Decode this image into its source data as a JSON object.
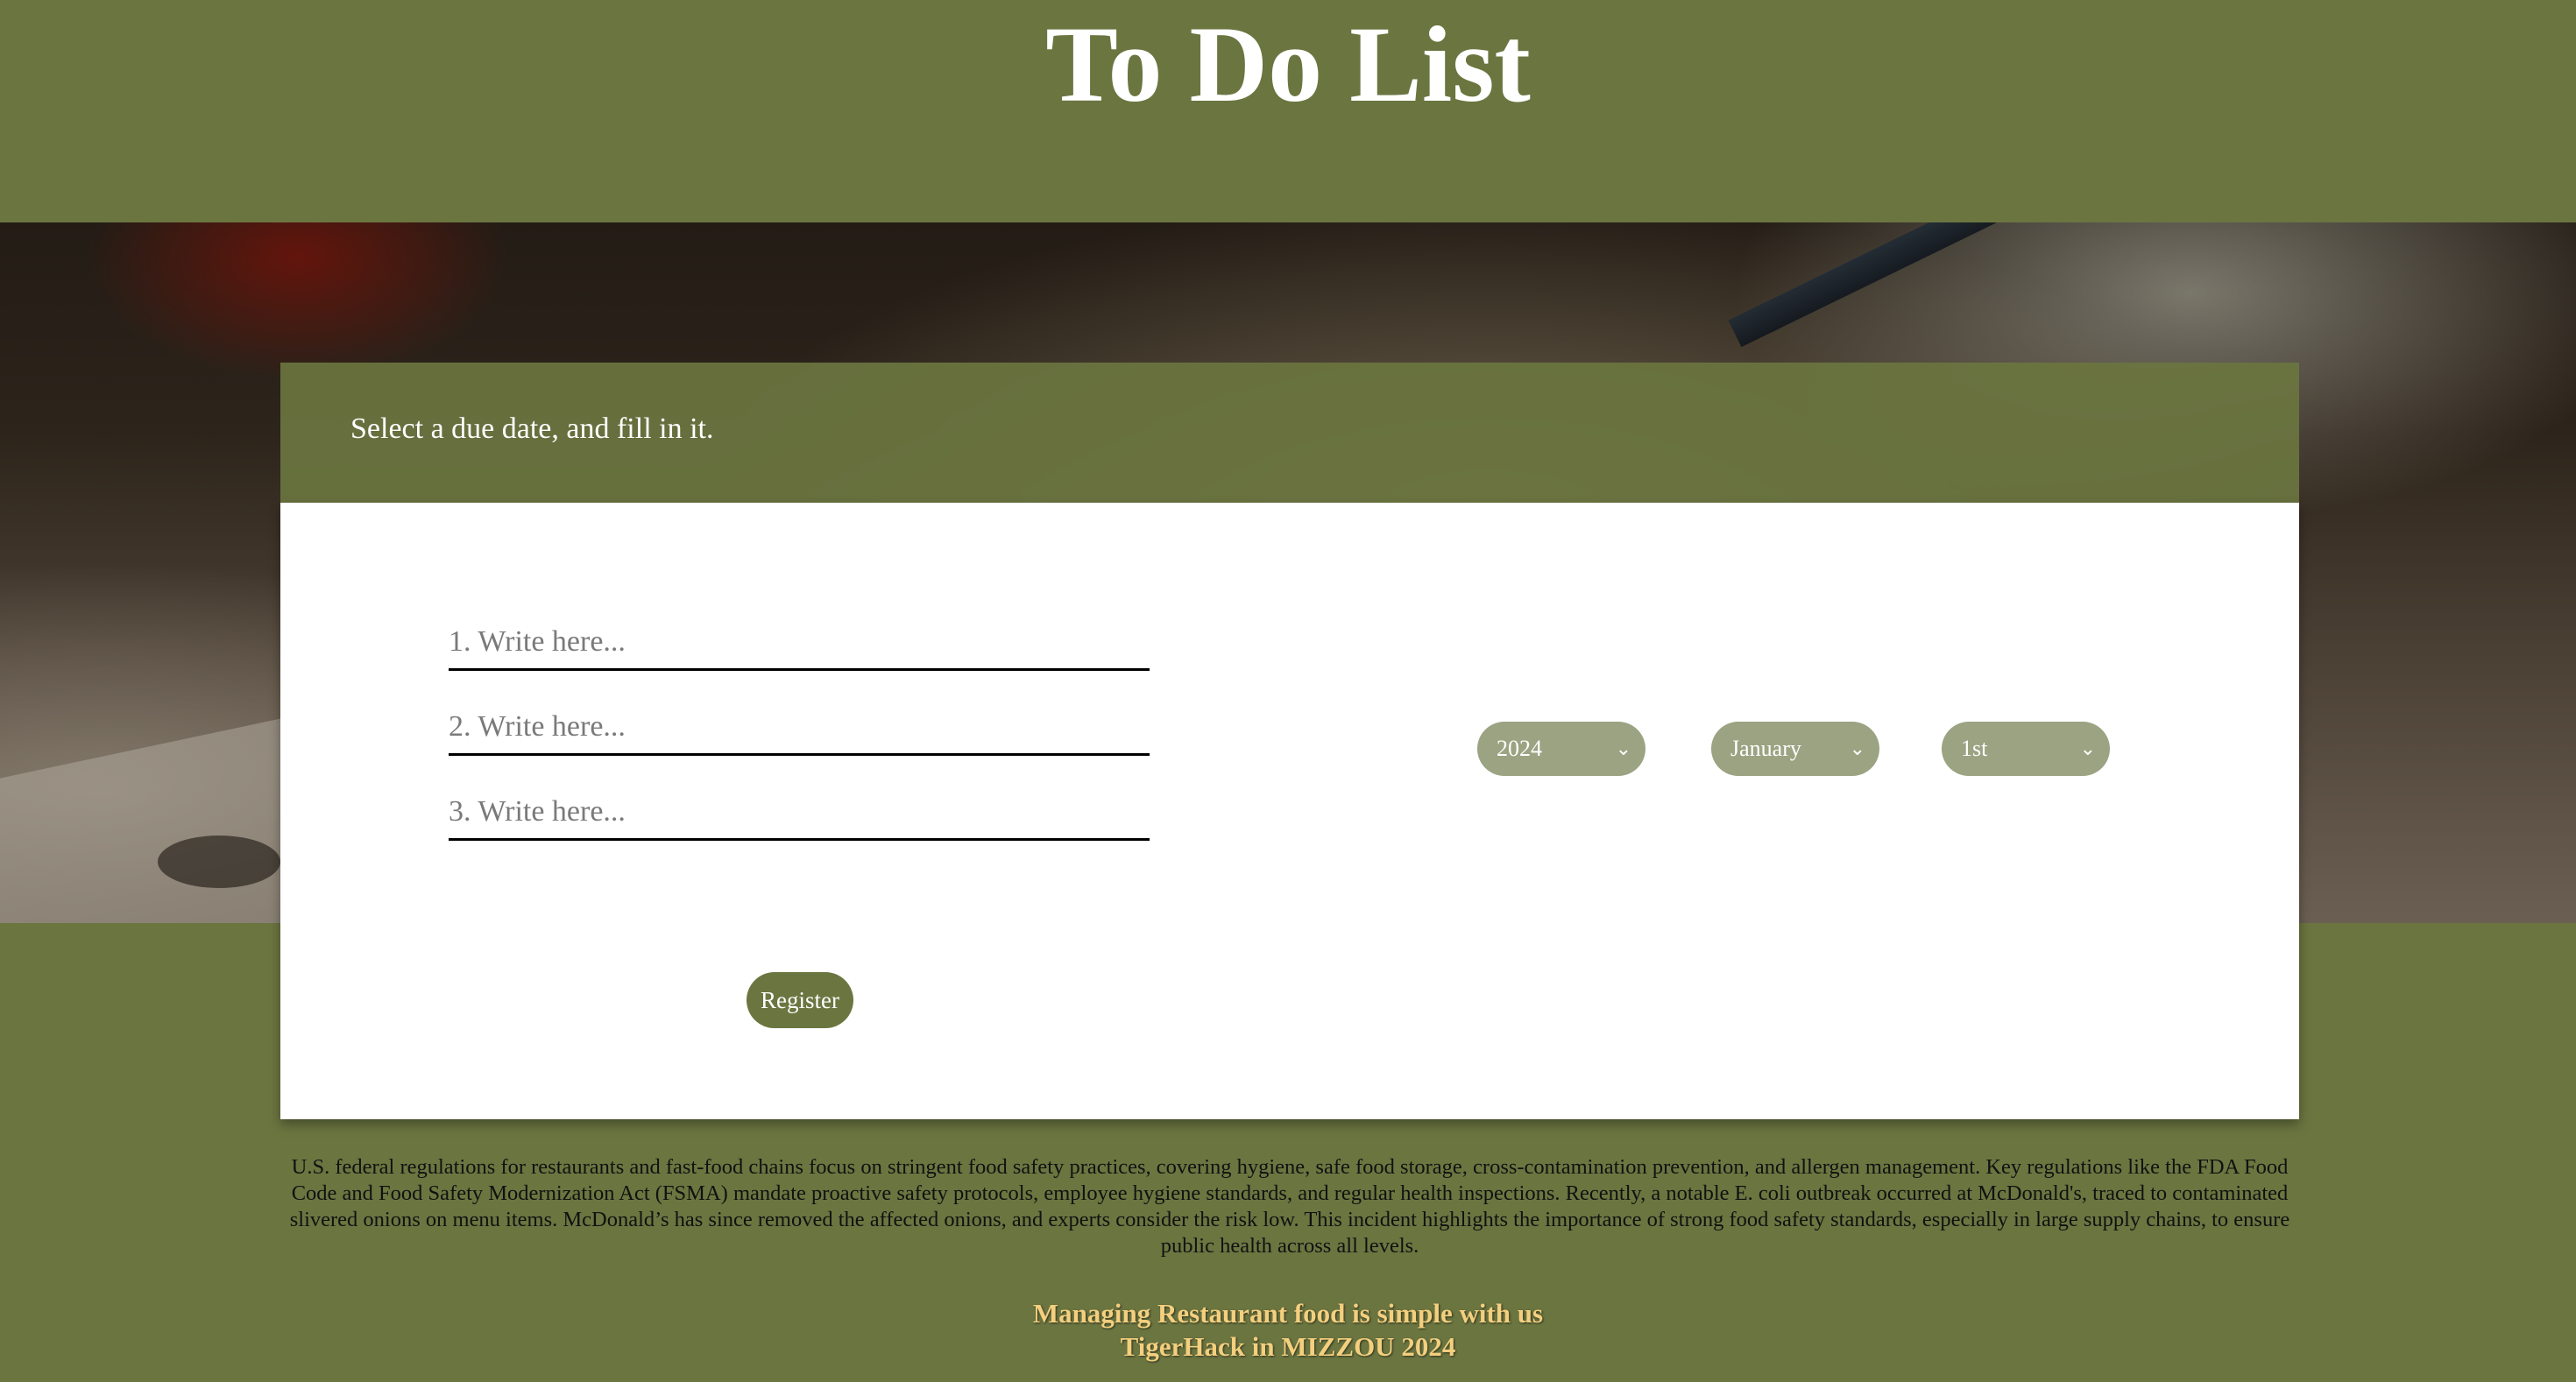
{
  "header": {
    "title": "To Do List"
  },
  "form": {
    "instruction": "Select a due date, and fill in it.",
    "task_placeholders": [
      "1. Write here...",
      "2. Write here...",
      "3. Write here..."
    ],
    "year": {
      "selected": "2024"
    },
    "month": {
      "selected": "January"
    },
    "day": {
      "selected": "1st"
    },
    "register_label": "Register"
  },
  "footer": {
    "paragraph": "U.S. federal regulations for restaurants and fast-food chains focus on stringent food safety practices, covering hygiene, safe food storage, cross-contamination prevention, and allergen management. Key regulations like the FDA Food Code and Food Safety Modernization Act (FSMA) mandate proactive safety protocols, employee hygiene standards, and regular health inspections. Recently, a notable E. coli outbreak occurred at McDonald's, traced to contaminated slivered onions on menu items. McDonald’s has since removed the affected onions, and experts consider the risk low. This incident highlights the importance of strong food safety standards, especially in large supply chains, to ensure public health across all levels.",
    "tagline_1": "Managing Restaurant food is simple with us",
    "tagline_2": "TigerHack in MIZZOU 2024"
  },
  "colors": {
    "brand_olive": "#6b7540",
    "select_fill": "#9ba382",
    "tagline_gold": "#f3cf7e"
  },
  "icons": {
    "select_chevron": "chevron-down-icon"
  }
}
